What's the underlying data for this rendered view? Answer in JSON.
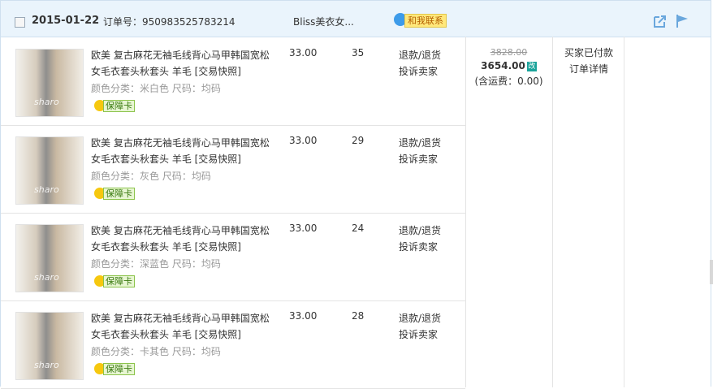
{
  "order": {
    "date": "2015-01-22",
    "order_no_label": "订单号：",
    "order_no": "950983525783214",
    "shop": "Bliss美衣女...",
    "contact_label": "和我联系",
    "orig_price": "3828.00",
    "total": "3654.00",
    "modified_mark": "改",
    "shipping": "(含运费：0.00)",
    "status": "买家已付款",
    "detail_link": "订单详情"
  },
  "items": [
    {
      "title": "欧美 复古麻花无袖毛线背心马甲韩国宽松女毛衣套头秋套头 羊毛 [交易快照]",
      "sku": "颜色分类：米白色 尺码：均码",
      "badge": "保障卡",
      "price": "33.00",
      "qty": "35",
      "refund": "退款/退货",
      "complain": "投诉卖家",
      "watermark": "sharo"
    },
    {
      "title": "欧美 复古麻花无袖毛线背心马甲韩国宽松女毛衣套头秋套头 羊毛 [交易快照]",
      "sku": "颜色分类：灰色 尺码：均码",
      "badge": "保障卡",
      "price": "33.00",
      "qty": "29",
      "refund": "退款/退货",
      "complain": "投诉卖家",
      "watermark": "sharo"
    },
    {
      "title": "欧美 复古麻花无袖毛线背心马甲韩国宽松女毛衣套头秋套头 羊毛 [交易快照]",
      "sku": "颜色分类：深蓝色 尺码：均码",
      "badge": "保障卡",
      "price": "33.00",
      "qty": "24",
      "refund": "退款/退货",
      "complain": "投诉卖家",
      "watermark": "sharo"
    },
    {
      "title": "欧美 复古麻花无袖毛线背心马甲韩国宽松女毛衣套头秋套头 羊毛 [交易快照]",
      "sku": "颜色分类：卡其色 尺码：均码",
      "badge": "保障卡",
      "price": "33.00",
      "qty": "28",
      "refund": "退款/退货",
      "complain": "投诉卖家",
      "watermark": "sharo"
    }
  ],
  "icons": {
    "share": "share-icon",
    "flag": "flag-icon",
    "wangwang": "wangwang-chat-icon",
    "guarantee": "guarantee-lamp-icon"
  },
  "colors": {
    "header_bg": "#eaf4fc",
    "border": "#cfe0ef",
    "modified": "#1aa39a"
  }
}
